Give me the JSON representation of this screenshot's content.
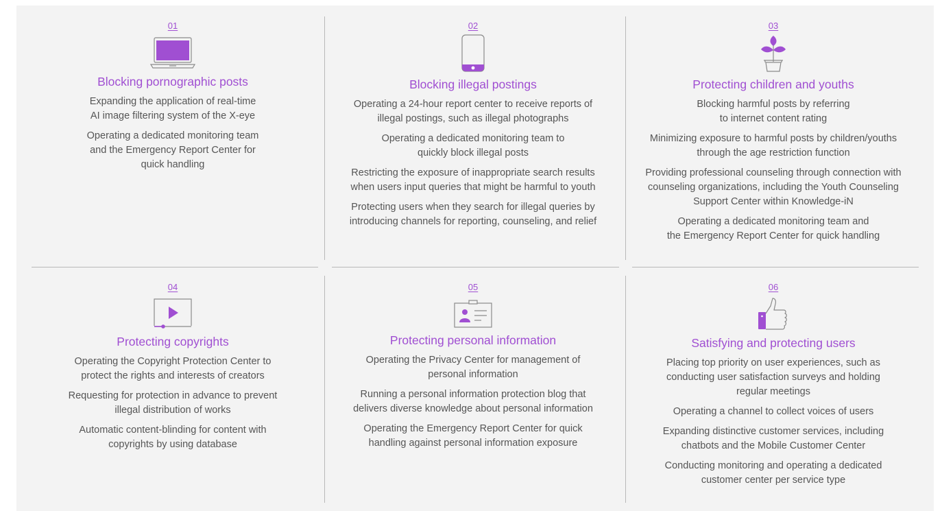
{
  "accent_color": "#a04fd2",
  "cards": [
    {
      "number": "01",
      "icon": "laptop-icon",
      "title": "Blocking pornographic posts",
      "items": [
        "Expanding the application of real-time\nAI image filtering system of the X-eye",
        "Operating a dedicated monitoring team\nand the Emergency Report Center for\nquick handling"
      ]
    },
    {
      "number": "02",
      "icon": "smartphone-icon",
      "title": "Blocking illegal postings",
      "items": [
        "Operating a 24-hour report center to receive reports of\nillegal postings, such as illegal photographs",
        "Operating a dedicated monitoring team to\nquickly block illegal posts",
        "Restricting the exposure of inappropriate search results\nwhen users input queries that might be harmful to youth",
        "Protecting users when they search for illegal queries by\nintroducing channels for reporting, counseling, and relief"
      ]
    },
    {
      "number": "03",
      "icon": "sprout-plant-icon",
      "title": "Protecting children and youths",
      "items": [
        "Blocking harmful posts by referring\nto internet content rating",
        "Minimizing exposure to harmful posts by children/youths\nthrough the age restriction function",
        "Providing professional counseling through connection with\ncounseling organizations, including the Youth Counseling\nSupport Center within Knowledge-iN",
        "Operating a dedicated monitoring team and\nthe Emergency Report Center for quick handling"
      ]
    },
    {
      "number": "04",
      "icon": "video-player-icon",
      "title": "Protecting copyrights",
      "items": [
        "Operating the Copyright Protection Center to\nprotect the rights and interests of creators",
        "Requesting for protection in advance to prevent\nillegal distribution of works",
        "Automatic content-blinding for content with\ncopyrights by using database"
      ]
    },
    {
      "number": "05",
      "icon": "id-card-icon",
      "title": "Protecting personal information",
      "items": [
        "Operating the Privacy Center for management of\npersonal information",
        "Running a personal information protection blog that\ndelivers diverse knowledge about personal information",
        "Operating the Emergency Report Center for quick\nhandling against personal information exposure"
      ]
    },
    {
      "number": "06",
      "icon": "thumbs-up-icon",
      "title": "Satisfying and protecting users",
      "items": [
        "Placing top priority on user experiences, such as\nconducting user satisfaction surveys and holding\nregular meetings",
        "Operating a channel to collect voices of users",
        "Expanding distinctive customer services, including\nchatbots and the Mobile Customer Center",
        "Conducting monitoring and operating a dedicated\ncustomer center per service type"
      ]
    }
  ]
}
